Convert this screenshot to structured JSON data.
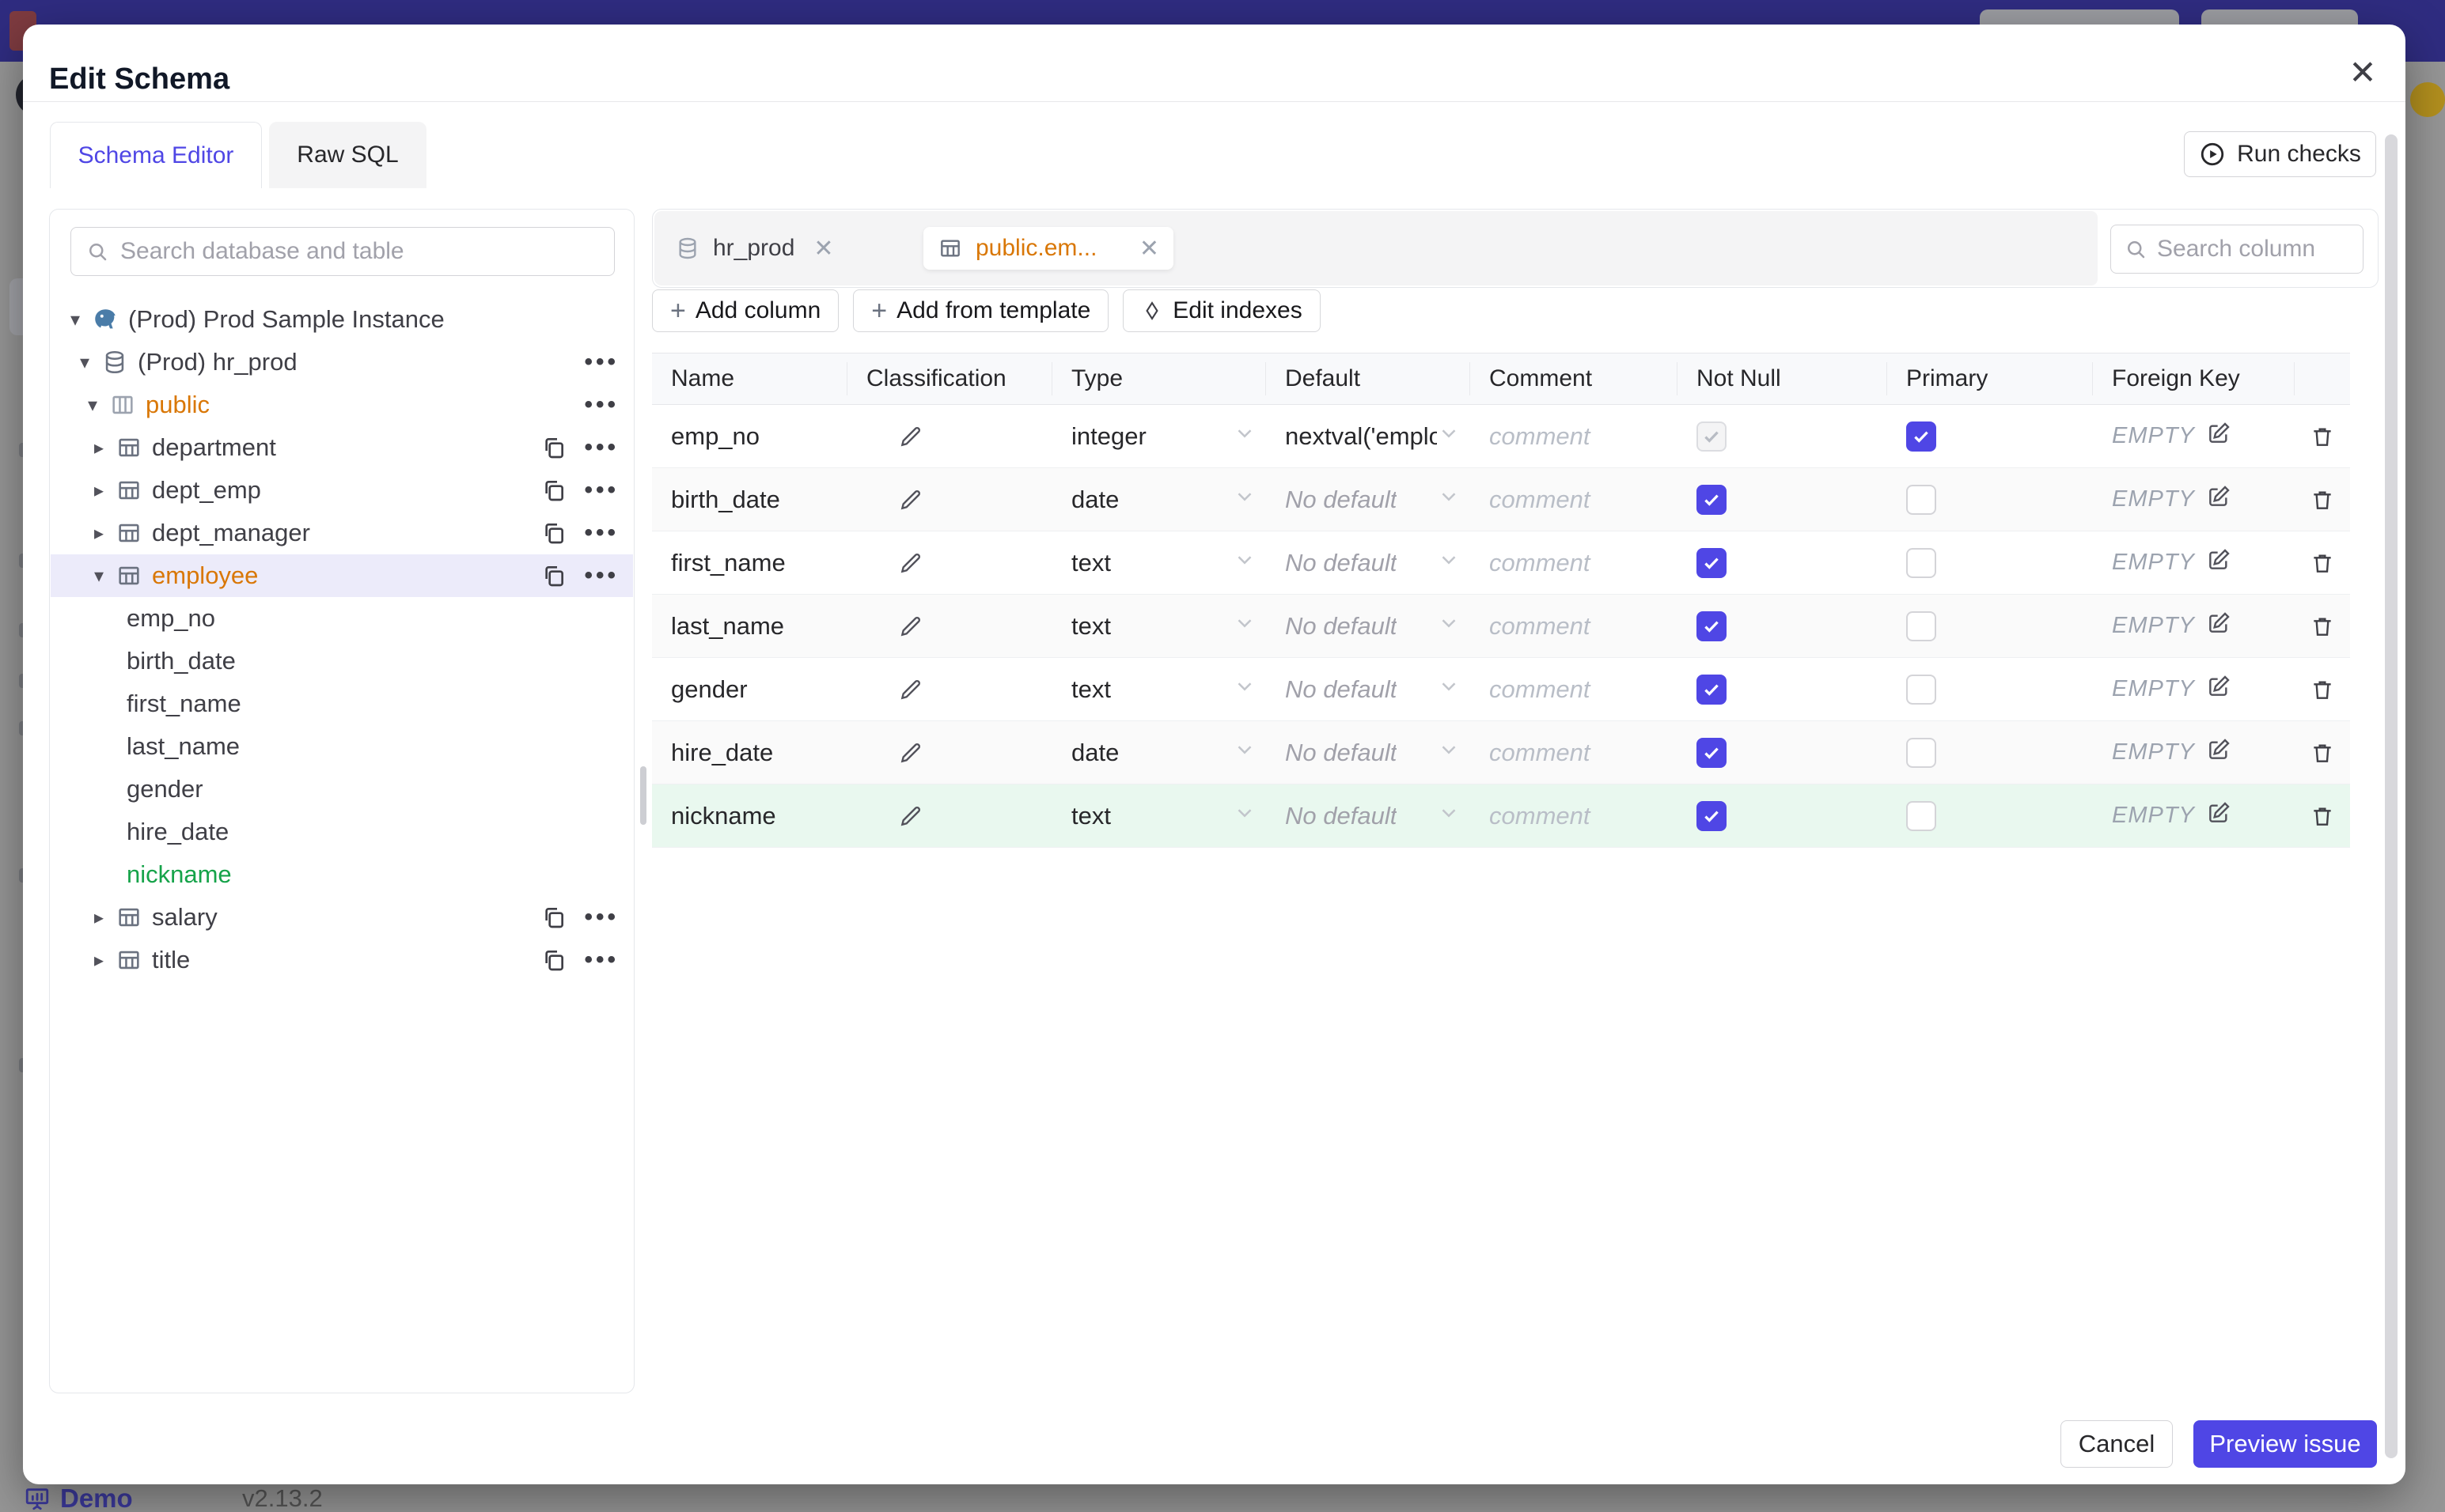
{
  "background": {
    "demo_label": "Demo",
    "version": "v2.13.2"
  },
  "modal": {
    "title": "Edit Schema",
    "tabs": [
      {
        "label": "Schema Editor",
        "active": true
      },
      {
        "label": "Raw SQL",
        "active": false
      }
    ],
    "run_checks_label": "Run checks",
    "sidebar": {
      "search_placeholder": "Search database and table",
      "tree": [
        {
          "label": "(Prod) Prod Sample Instance",
          "type": "instance",
          "level": 0,
          "expanded": true
        },
        {
          "label": "(Prod) hr_prod",
          "type": "database",
          "level": 1,
          "expanded": true
        },
        {
          "label": "public",
          "type": "schema",
          "level": 2,
          "expanded": true,
          "state": "modified"
        },
        {
          "label": "department",
          "type": "table",
          "level": 3,
          "expanded": false
        },
        {
          "label": "dept_emp",
          "type": "table",
          "level": 3,
          "expanded": false
        },
        {
          "label": "dept_manager",
          "type": "table",
          "level": 3,
          "expanded": false
        },
        {
          "label": "employee",
          "type": "table",
          "level": 3,
          "expanded": true,
          "selected": true,
          "state": "modified"
        },
        {
          "label": "emp_no",
          "type": "column",
          "level": 4
        },
        {
          "label": "birth_date",
          "type": "column",
          "level": 4
        },
        {
          "label": "first_name",
          "type": "column",
          "level": 4
        },
        {
          "label": "last_name",
          "type": "column",
          "level": 4
        },
        {
          "label": "gender",
          "type": "column",
          "level": 4
        },
        {
          "label": "hire_date",
          "type": "column",
          "level": 4
        },
        {
          "label": "nickname",
          "type": "column",
          "level": 4,
          "state": "added"
        },
        {
          "label": "salary",
          "type": "table",
          "level": 3,
          "expanded": false
        },
        {
          "label": "title",
          "type": "table",
          "level": 3,
          "expanded": false
        }
      ]
    },
    "editor": {
      "chips": [
        {
          "label": "hr_prod",
          "icon": "database-icon",
          "active": false
        },
        {
          "label": "public.em...",
          "icon": "table-icon",
          "active": true
        }
      ],
      "column_search_placeholder": "Search column",
      "toolbar": {
        "add_column": "Add column",
        "add_from_template": "Add from template",
        "edit_indexes": "Edit indexes"
      },
      "table": {
        "headers": [
          "Name",
          "Classification",
          "Type",
          "Default",
          "Comment",
          "Not Null",
          "Primary",
          "Foreign Key"
        ],
        "comment_placeholder": "comment",
        "foreign_key_value": "EMPTY",
        "rows": [
          {
            "name": "emp_no",
            "type": "integer",
            "default": "nextval('employ",
            "has_default": true,
            "not_null": true,
            "not_null_disabled": true,
            "primary": true,
            "added": false
          },
          {
            "name": "birth_date",
            "type": "date",
            "default": "No default",
            "has_default": false,
            "not_null": true,
            "primary": false,
            "added": false
          },
          {
            "name": "first_name",
            "type": "text",
            "default": "No default",
            "has_default": false,
            "not_null": true,
            "primary": false,
            "added": false
          },
          {
            "name": "last_name",
            "type": "text",
            "default": "No default",
            "has_default": false,
            "not_null": true,
            "primary": false,
            "added": false
          },
          {
            "name": "gender",
            "type": "text",
            "default": "No default",
            "has_default": false,
            "not_null": true,
            "primary": false,
            "added": false
          },
          {
            "name": "hire_date",
            "type": "date",
            "default": "No default",
            "has_default": false,
            "not_null": true,
            "primary": false,
            "added": false
          },
          {
            "name": "nickname",
            "type": "text",
            "default": "No default",
            "has_default": false,
            "not_null": true,
            "primary": false,
            "added": true
          }
        ]
      }
    },
    "footer": {
      "cancel": "Cancel",
      "preview": "Preview issue"
    }
  },
  "icons": {
    "close": "✕",
    "add": "+",
    "more": "•••",
    "caret_expanded": "▾",
    "caret_collapsed": "▸"
  },
  "colors": {
    "accent": "#4f46e5",
    "modified_text": "#d97706",
    "added_text": "#16a34a",
    "added_row_bg": "#e9f8ef",
    "selected_row_bg": "#ecebfa",
    "topbar": "#2f2c80"
  }
}
